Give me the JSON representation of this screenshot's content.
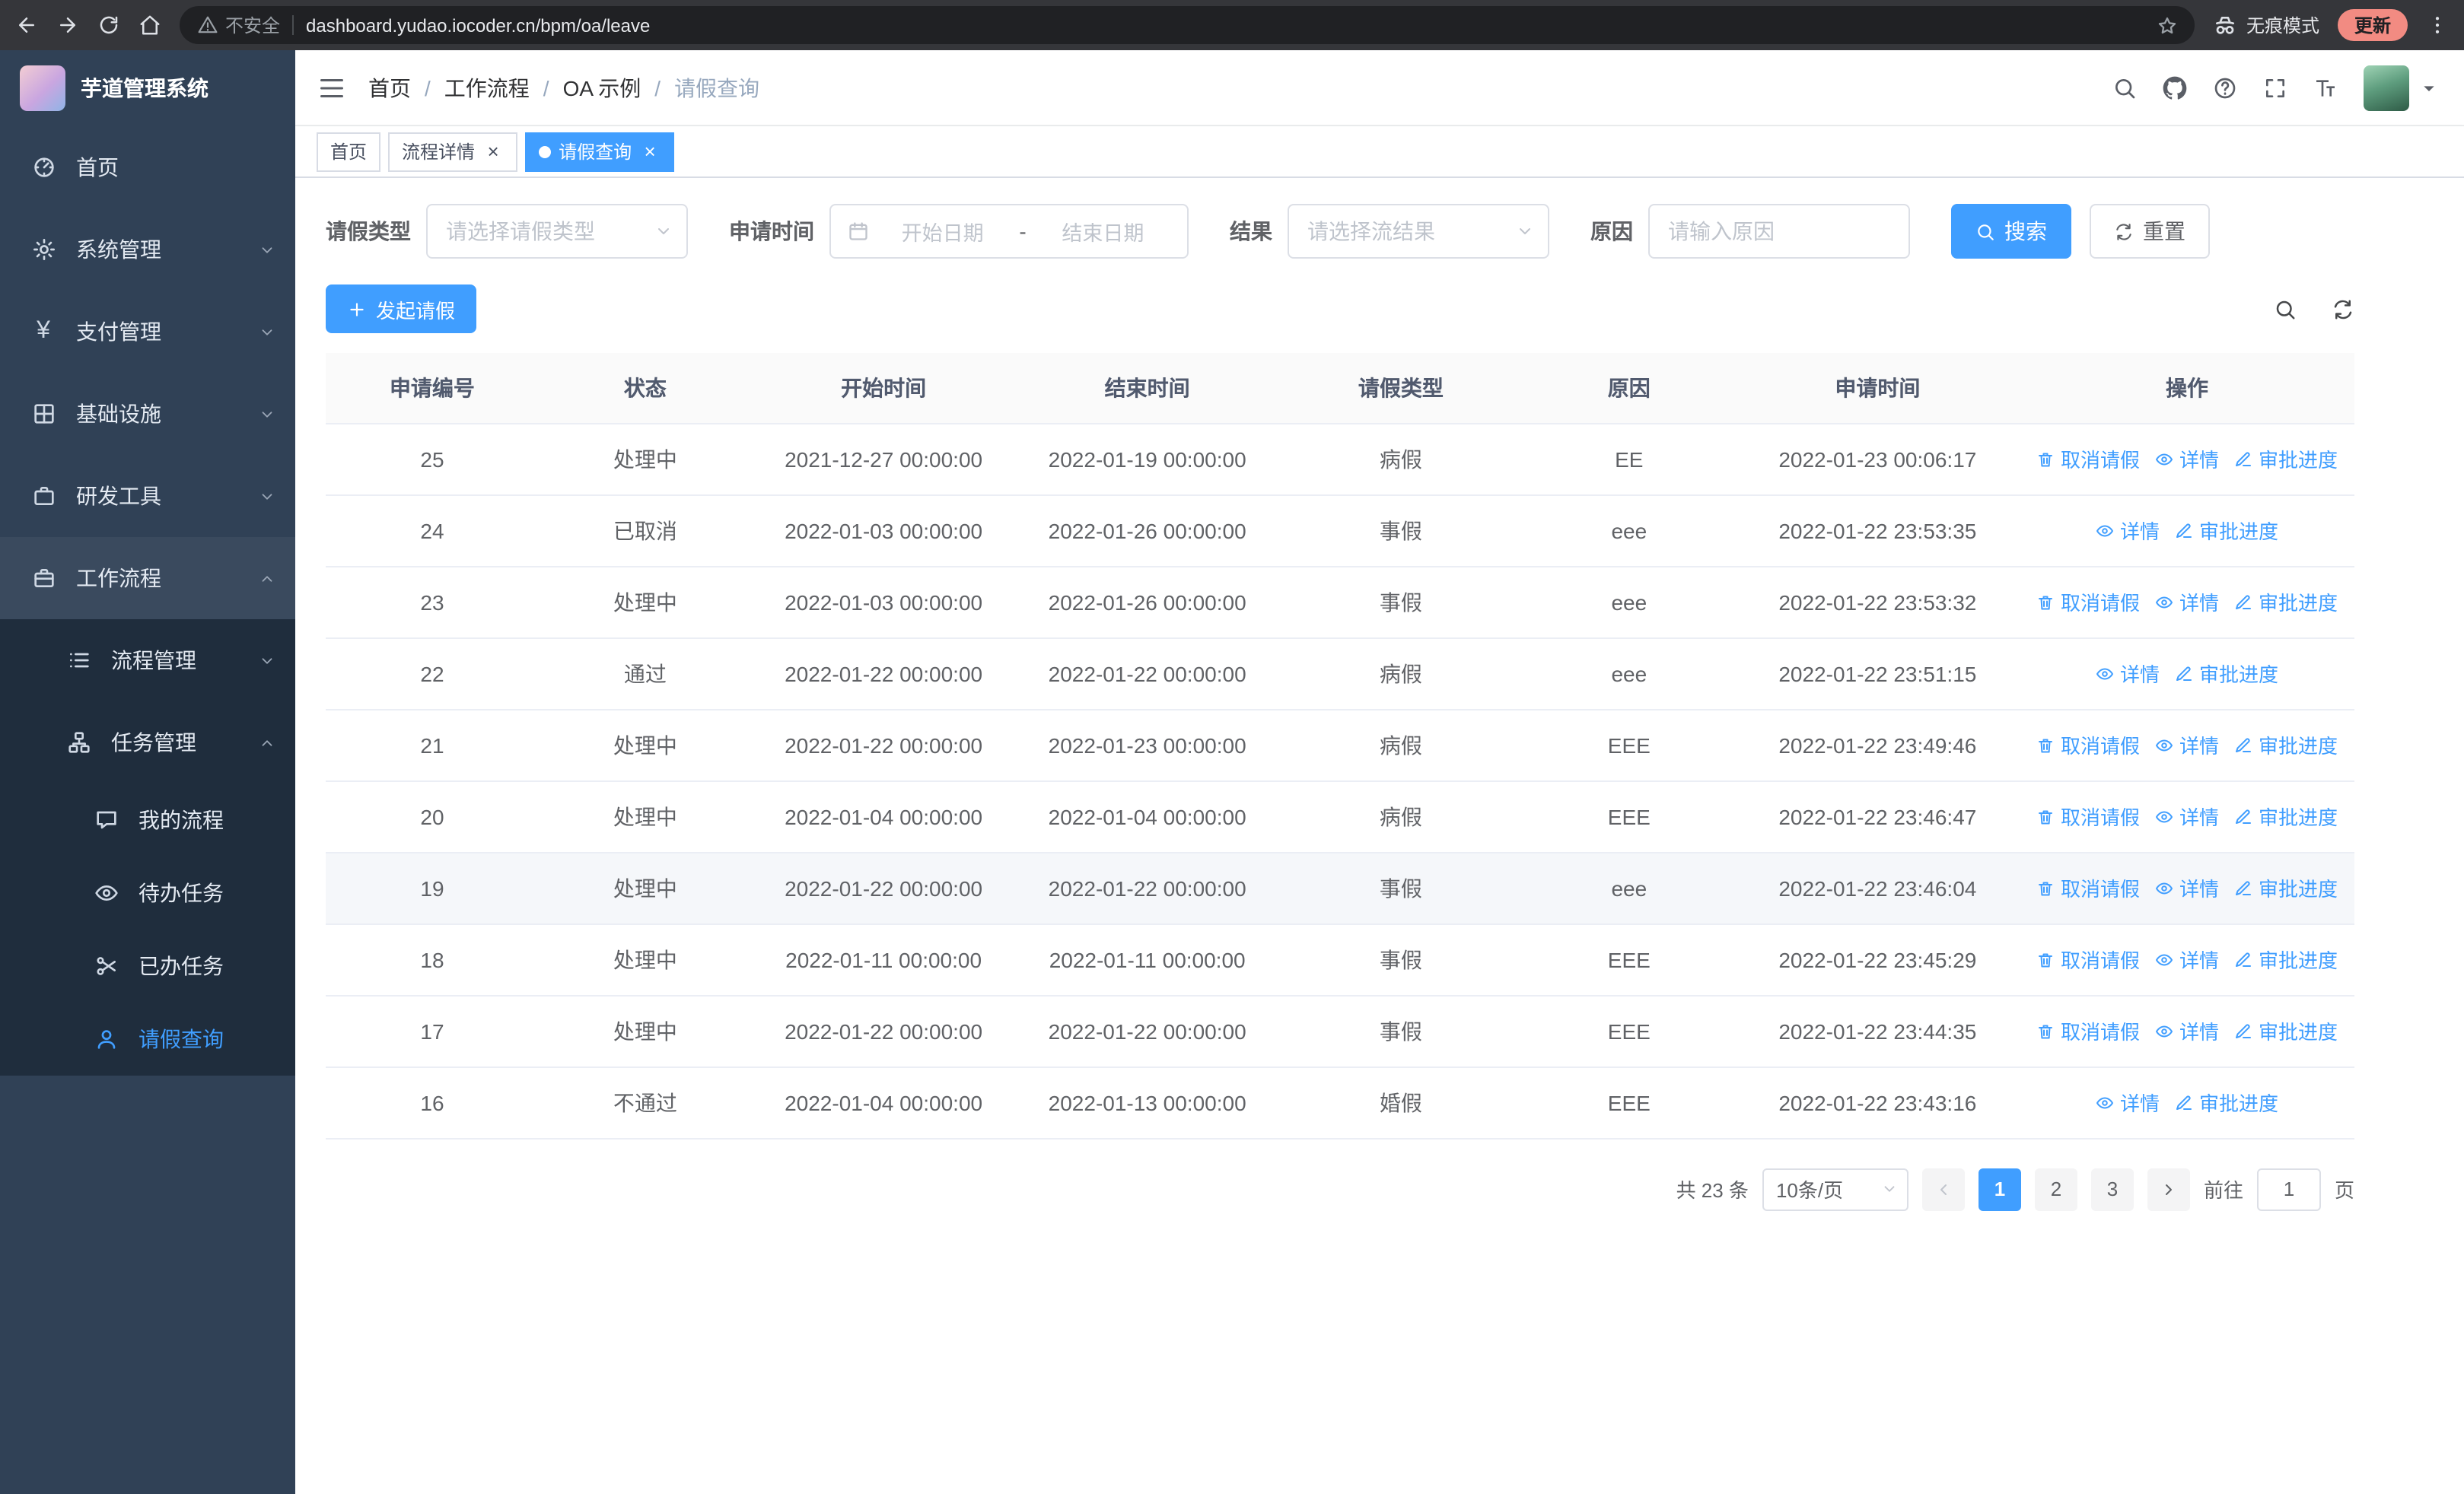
{
  "colors": {
    "accent": "#409eff",
    "sidebar_bg": "#304156",
    "submenu_bg": "#1f2d3d",
    "chrome_bg": "#35363a",
    "update_badge_bg": "#f28b82",
    "row_hover_bg": "#f5f7fa"
  },
  "browser": {
    "security_label": "不安全",
    "url": "dashboard.yudao.iocoder.cn/bpm/oa/leave",
    "incognito_label": "无痕模式",
    "update_label": "更新"
  },
  "sidebar": {
    "logo_title": "芋道管理系统",
    "items": [
      {
        "key": "home",
        "label": "首页",
        "icon": "dashboard"
      },
      {
        "key": "system",
        "label": "系统管理",
        "icon": "gear",
        "chevron": "down"
      },
      {
        "key": "payment",
        "label": "支付管理",
        "icon": "yen",
        "chevron": "down"
      },
      {
        "key": "infrastructure",
        "label": "基础设施",
        "icon": "grid",
        "chevron": "down"
      },
      {
        "key": "devtools",
        "label": "研发工具",
        "icon": "toolbox",
        "chevron": "down"
      },
      {
        "key": "workflow",
        "label": "工作流程",
        "icon": "briefcase",
        "chevron": "up",
        "open": true
      }
    ],
    "submenu": [
      {
        "key": "process-mgmt",
        "label": "流程管理",
        "icon": "list",
        "chevron": "down"
      },
      {
        "key": "task-mgmt",
        "label": "任务管理",
        "icon": "tree",
        "chevron": "up",
        "open": true
      }
    ],
    "subsubmenu": [
      {
        "key": "my-process",
        "label": "我的流程",
        "icon": "chat"
      },
      {
        "key": "todo-tasks",
        "label": "待办任务",
        "icon": "eye"
      },
      {
        "key": "done-tasks",
        "label": "已办任务",
        "icon": "scissors"
      },
      {
        "key": "leave-query",
        "label": "请假查询",
        "icon": "user",
        "active": true
      }
    ]
  },
  "header": {
    "breadcrumb": [
      "首页",
      "工作流程",
      "OA 示例",
      "请假查询"
    ]
  },
  "tabs": [
    {
      "key": "home",
      "label": "首页",
      "closable": false,
      "active": false
    },
    {
      "key": "process-detail",
      "label": "流程详情",
      "closable": true,
      "active": false
    },
    {
      "key": "leave-query",
      "label": "请假查询",
      "closable": true,
      "active": true
    }
  ],
  "filters": {
    "leave_type_label": "请假类型",
    "leave_type_placeholder": "请选择请假类型",
    "apply_time_label": "申请时间",
    "start_date_placeholder": "开始日期",
    "range_separator": "-",
    "end_date_placeholder": "结束日期",
    "result_label": "结果",
    "result_placeholder": "请选择流结果",
    "reason_label": "原因",
    "reason_placeholder": "请输入原因",
    "search_button": "搜索",
    "reset_button": "重置"
  },
  "toolbar": {
    "create_button": "发起请假"
  },
  "table": {
    "columns": [
      "申请编号",
      "状态",
      "开始时间",
      "结束时间",
      "请假类型",
      "原因",
      "申请时间",
      "操作"
    ],
    "action_labels": {
      "cancel": "取消请假",
      "detail": "详情",
      "progress": "审批进度"
    },
    "rows": [
      {
        "id": "25",
        "status": "处理中",
        "start": "2021-12-27 00:00:00",
        "end": "2022-01-19 00:00:00",
        "type": "病假",
        "reason": "EE",
        "applied": "2022-01-23 00:06:17",
        "actions": [
          "cancel",
          "detail",
          "progress"
        ],
        "highlighted": false
      },
      {
        "id": "24",
        "status": "已取消",
        "start": "2022-01-03 00:00:00",
        "end": "2022-01-26 00:00:00",
        "type": "事假",
        "reason": "eee",
        "applied": "2022-01-22 23:53:35",
        "actions": [
          "detail",
          "progress"
        ],
        "highlighted": false
      },
      {
        "id": "23",
        "status": "处理中",
        "start": "2022-01-03 00:00:00",
        "end": "2022-01-26 00:00:00",
        "type": "事假",
        "reason": "eee",
        "applied": "2022-01-22 23:53:32",
        "actions": [
          "cancel",
          "detail",
          "progress"
        ],
        "highlighted": false
      },
      {
        "id": "22",
        "status": "通过",
        "start": "2022-01-22 00:00:00",
        "end": "2022-01-22 00:00:00",
        "type": "病假",
        "reason": "eee",
        "applied": "2022-01-22 23:51:15",
        "actions": [
          "detail",
          "progress"
        ],
        "highlighted": false
      },
      {
        "id": "21",
        "status": "处理中",
        "start": "2022-01-22 00:00:00",
        "end": "2022-01-23 00:00:00",
        "type": "病假",
        "reason": "EEE",
        "applied": "2022-01-22 23:49:46",
        "actions": [
          "cancel",
          "detail",
          "progress"
        ],
        "highlighted": false
      },
      {
        "id": "20",
        "status": "处理中",
        "start": "2022-01-04 00:00:00",
        "end": "2022-01-04 00:00:00",
        "type": "病假",
        "reason": "EEE",
        "applied": "2022-01-22 23:46:47",
        "actions": [
          "cancel",
          "detail",
          "progress"
        ],
        "highlighted": false
      },
      {
        "id": "19",
        "status": "处理中",
        "start": "2022-01-22 00:00:00",
        "end": "2022-01-22 00:00:00",
        "type": "事假",
        "reason": "eee",
        "applied": "2022-01-22 23:46:04",
        "actions": [
          "cancel",
          "detail",
          "progress"
        ],
        "highlighted": true
      },
      {
        "id": "18",
        "status": "处理中",
        "start": "2022-01-11 00:00:00",
        "end": "2022-01-11 00:00:00",
        "type": "事假",
        "reason": "EEE",
        "applied": "2022-01-22 23:45:29",
        "actions": [
          "cancel",
          "detail",
          "progress"
        ],
        "highlighted": false
      },
      {
        "id": "17",
        "status": "处理中",
        "start": "2022-01-22 00:00:00",
        "end": "2022-01-22 00:00:00",
        "type": "事假",
        "reason": "EEE",
        "applied": "2022-01-22 23:44:35",
        "actions": [
          "cancel",
          "detail",
          "progress"
        ],
        "highlighted": false
      },
      {
        "id": "16",
        "status": "不通过",
        "start": "2022-01-04 00:00:00",
        "end": "2022-01-13 00:00:00",
        "type": "婚假",
        "reason": "EEE",
        "applied": "2022-01-22 23:43:16",
        "actions": [
          "detail",
          "progress"
        ],
        "highlighted": false
      }
    ]
  },
  "pagination": {
    "total_text": "共 23 条",
    "page_size": "10条/页",
    "pages": [
      "1",
      "2",
      "3"
    ],
    "active_page": "1",
    "goto_label": "前往",
    "goto_value": "1",
    "page_label": "页"
  }
}
